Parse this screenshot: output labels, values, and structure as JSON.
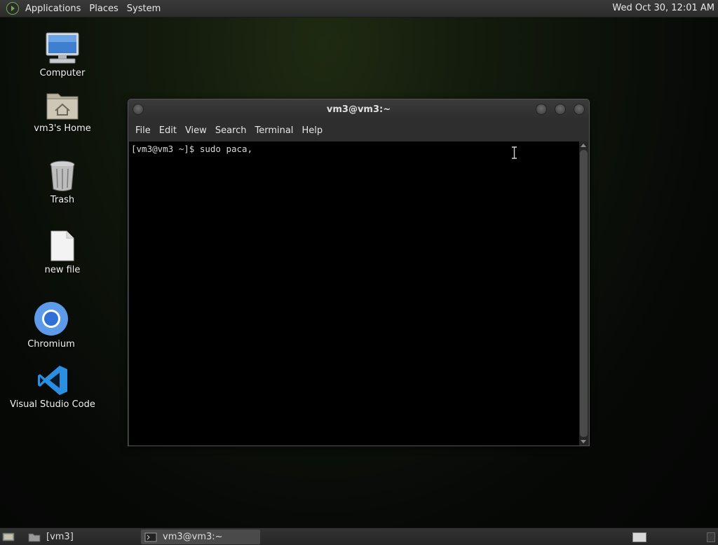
{
  "top_panel": {
    "menus": [
      "Applications",
      "Places",
      "System"
    ],
    "clock": "Wed Oct 30, 12:01 AM",
    "logo_icon": "gnome-foot-icon"
  },
  "desktop": {
    "icons": [
      {
        "label": "Computer",
        "icon": "computer-monitor-icon"
      },
      {
        "label": "vm3's Home",
        "icon": "home-folder-icon"
      },
      {
        "label": "Trash",
        "icon": "trash-icon"
      },
      {
        "label": "new file",
        "icon": "file-icon"
      },
      {
        "label": "Chromium",
        "icon": "chromium-icon"
      },
      {
        "label": "Visual Studio Code",
        "icon": "vscode-icon"
      }
    ]
  },
  "terminal": {
    "title": "vm3@vm3:~",
    "menu": [
      "File",
      "Edit",
      "View",
      "Search",
      "Terminal",
      "Help"
    ],
    "lines": [
      "[vm3@vm3 ~]$ sudo paca,"
    ]
  },
  "bottom_panel": {
    "tasks": [
      {
        "label": "[vm3]",
        "icon": "folder-icon"
      },
      {
        "label": "vm3@vm3:~",
        "icon": "terminal-icon"
      }
    ]
  },
  "colors": {
    "panel": "#2c2c2c",
    "terminal_bg": "#000000",
    "accent_green": "#6fae4a"
  }
}
